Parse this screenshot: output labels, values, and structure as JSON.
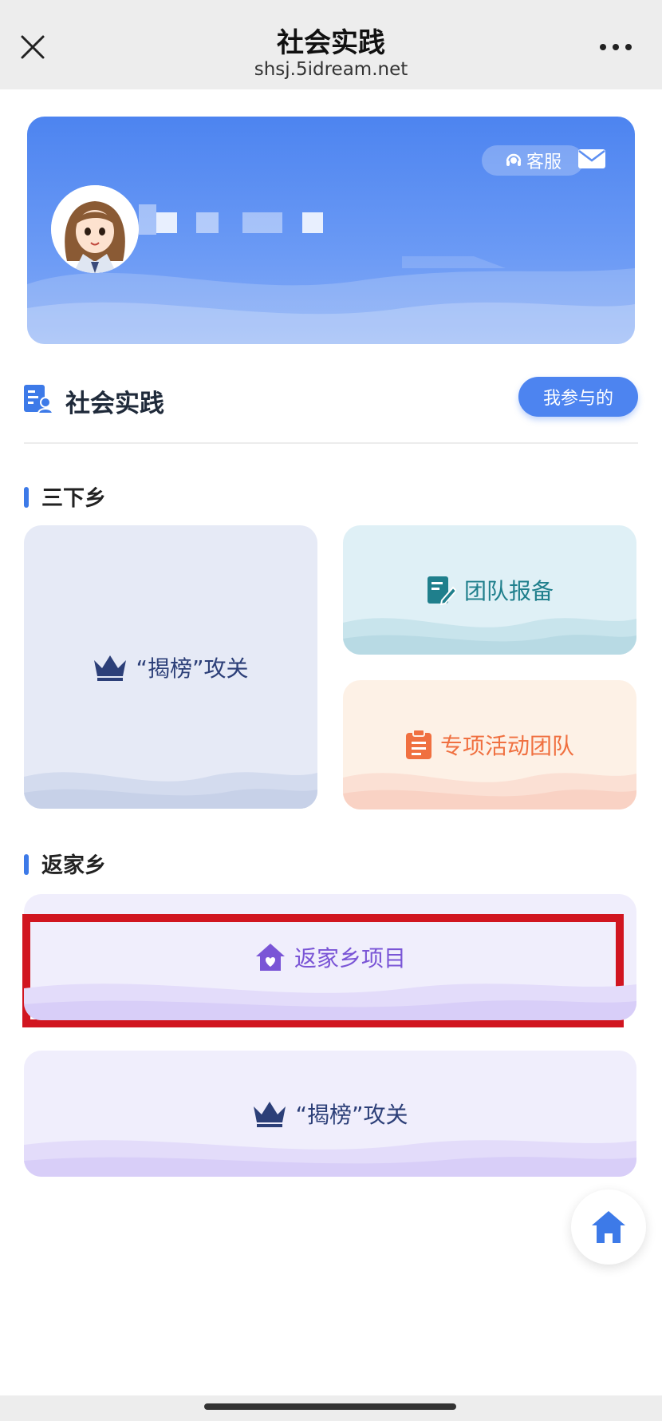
{
  "nav": {
    "title": "社会实践",
    "url": "shsj.5idream.net",
    "close_icon": "close-icon",
    "more_icon": "more-dots-icon"
  },
  "profile": {
    "service_label": "客服",
    "service_icon": "headset-icon",
    "mail_icon": "mail-icon",
    "avatar": "avatar"
  },
  "section": {
    "title": "社会实践",
    "my_participation_button": "我参与的"
  },
  "groups": [
    {
      "title": "三下乡",
      "cards": [
        {
          "label": "“揭榜”攻关",
          "icon": "crown-icon"
        },
        {
          "label": "团队报备",
          "icon": "edit-document-icon"
        },
        {
          "label": "专项活动团队",
          "icon": "clipboard-icon"
        }
      ]
    },
    {
      "title": "返家乡",
      "cards": [
        {
          "label": "返家乡项目",
          "icon": "home-heart-icon"
        },
        {
          "label": "“揭榜”攻关",
          "icon": "crown-icon"
        }
      ]
    }
  ],
  "fab": {
    "icon": "home-icon"
  },
  "colors": {
    "accent": "#4d84f0",
    "highlight_box": "#d11520",
    "crown": "#2c3f78",
    "teal": "#1f7f8c",
    "orange": "#f07040",
    "purple": "#7a55d6"
  }
}
